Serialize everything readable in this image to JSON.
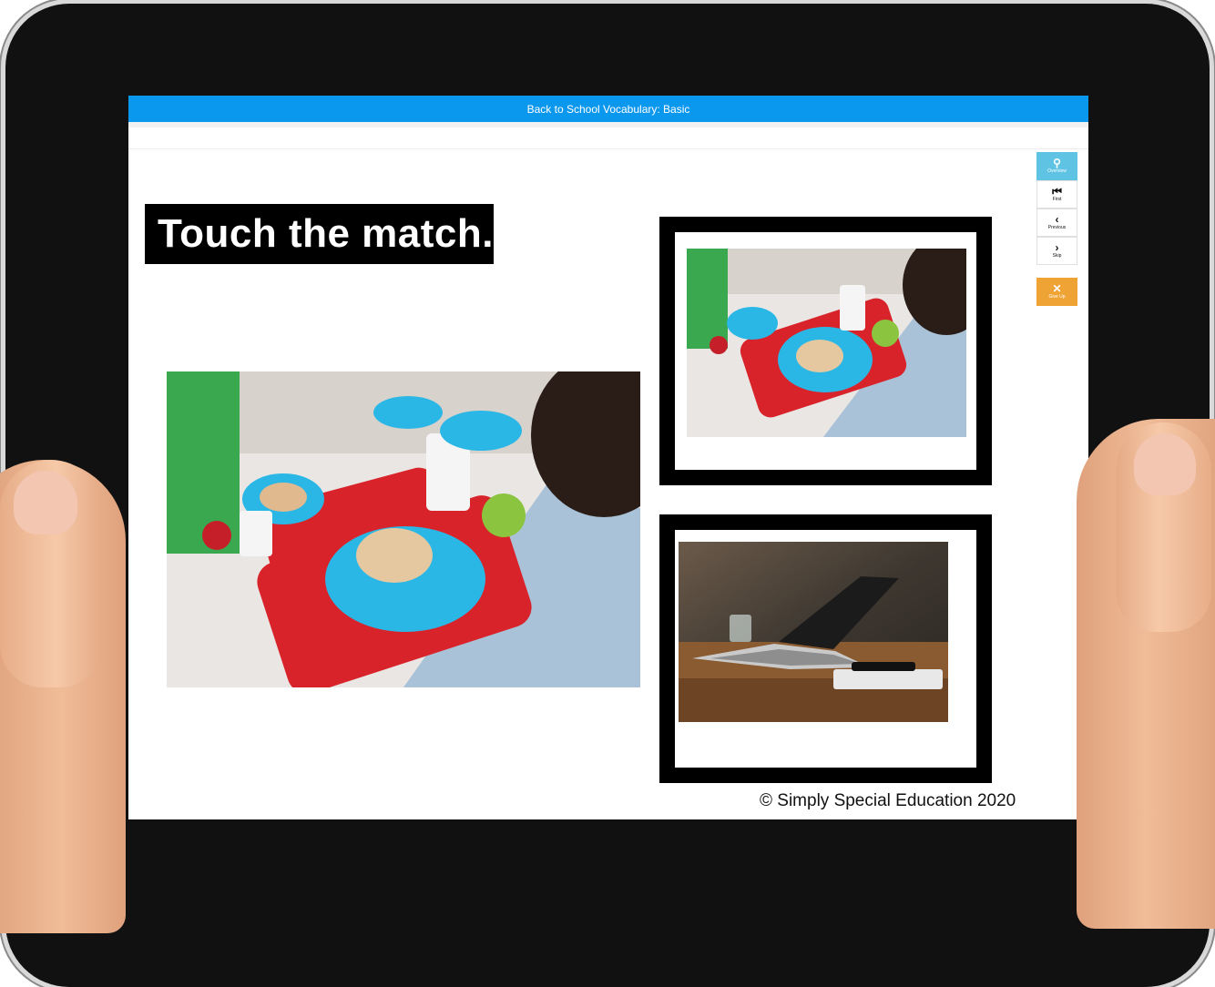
{
  "window": {
    "title": "Back to School Vocabulary: Basic"
  },
  "slide": {
    "prompt": "Touch the match.",
    "copyright": "© Simply Special Education 2020",
    "main_image": "cafeteria-lunch-trays",
    "choices": [
      {
        "image": "cafeteria-lunch-trays"
      },
      {
        "image": "laptop-on-table"
      }
    ]
  },
  "controls": {
    "items": [
      {
        "icon": "search-icon",
        "glyph": "⚲",
        "label": "Overview"
      },
      {
        "icon": "first-icon",
        "glyph": "⏮",
        "label": "First"
      },
      {
        "icon": "previous-icon",
        "glyph": "‹",
        "label": "Previous"
      },
      {
        "icon": "skip-icon",
        "glyph": "›",
        "label": "Skip"
      }
    ],
    "give_up": {
      "icon": "close-icon",
      "glyph": "✕",
      "label": "Give Up"
    }
  },
  "colors": {
    "titlebar": "#0a97ee",
    "overview_button": "#5fc3e4",
    "give_up_button": "#f0a335"
  }
}
